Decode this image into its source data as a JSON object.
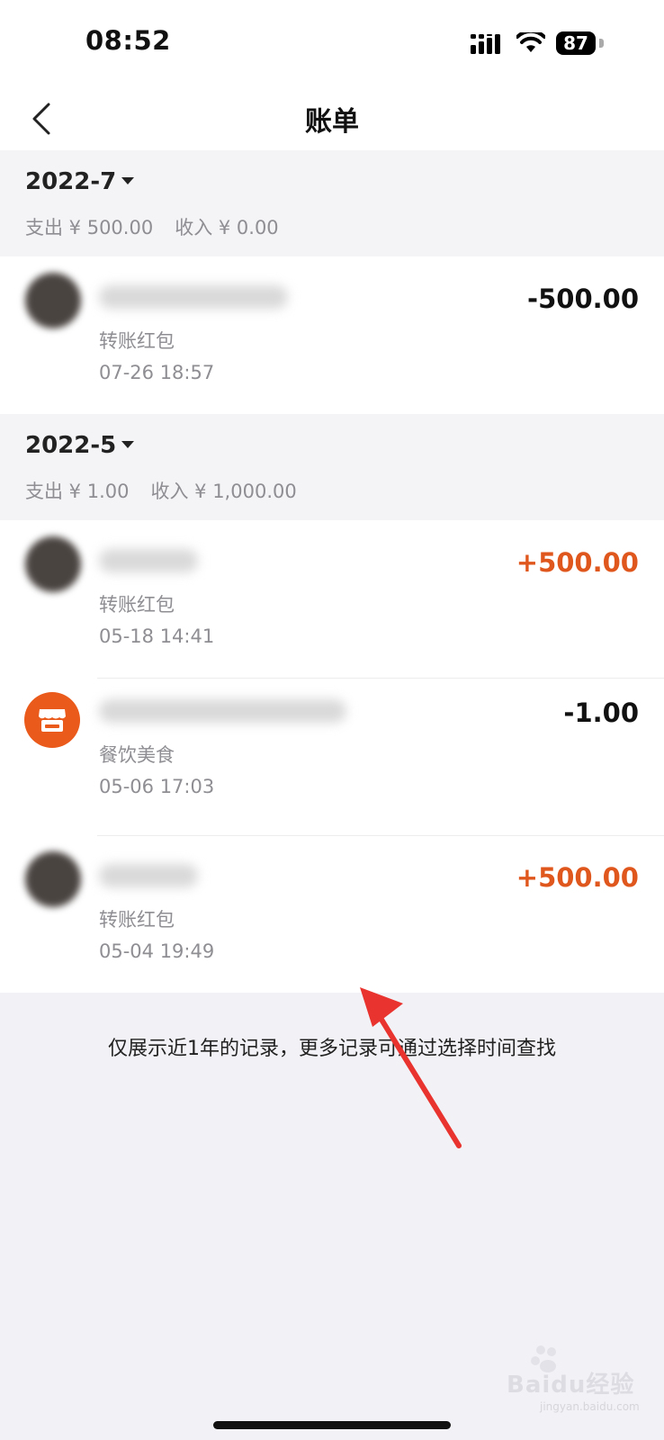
{
  "status_bar": {
    "time": "08:52",
    "battery": "87"
  },
  "nav": {
    "title": "账单",
    "back_icon": "chevron-left-icon"
  },
  "sections": [
    {
      "month": "2022-7",
      "expense": "支出 ¥ 500.00",
      "income": "收入 ¥ 0.00",
      "items": [
        {
          "category": "转账红包",
          "datetime": "07-26  18:57",
          "amount": "-500.00",
          "type": "expense"
        }
      ]
    },
    {
      "month": "2022-5",
      "expense": "支出 ¥ 1.00",
      "income": "收入 ¥ 1,000.00",
      "items": [
        {
          "category": "转账红包",
          "datetime": "05-18  14:41",
          "amount": "+500.00",
          "type": "income"
        },
        {
          "category": "餐饮美食",
          "datetime": "05-06  17:03",
          "amount": "-1.00",
          "type": "expense",
          "icon": "shop-icon"
        },
        {
          "category": "转账红包",
          "datetime": "05-04  19:49",
          "amount": "+500.00",
          "type": "income"
        }
      ]
    }
  ],
  "footer_note": "仅展示近1年的记录，更多记录可通过选择时间查找",
  "watermark": {
    "text": "Baidu经验",
    "url": "jingyan.baidu.com"
  },
  "colors": {
    "income": "#e0571d",
    "shop_icon_bg": "#ea5a1a",
    "page_bg": "#f2f2f6"
  }
}
